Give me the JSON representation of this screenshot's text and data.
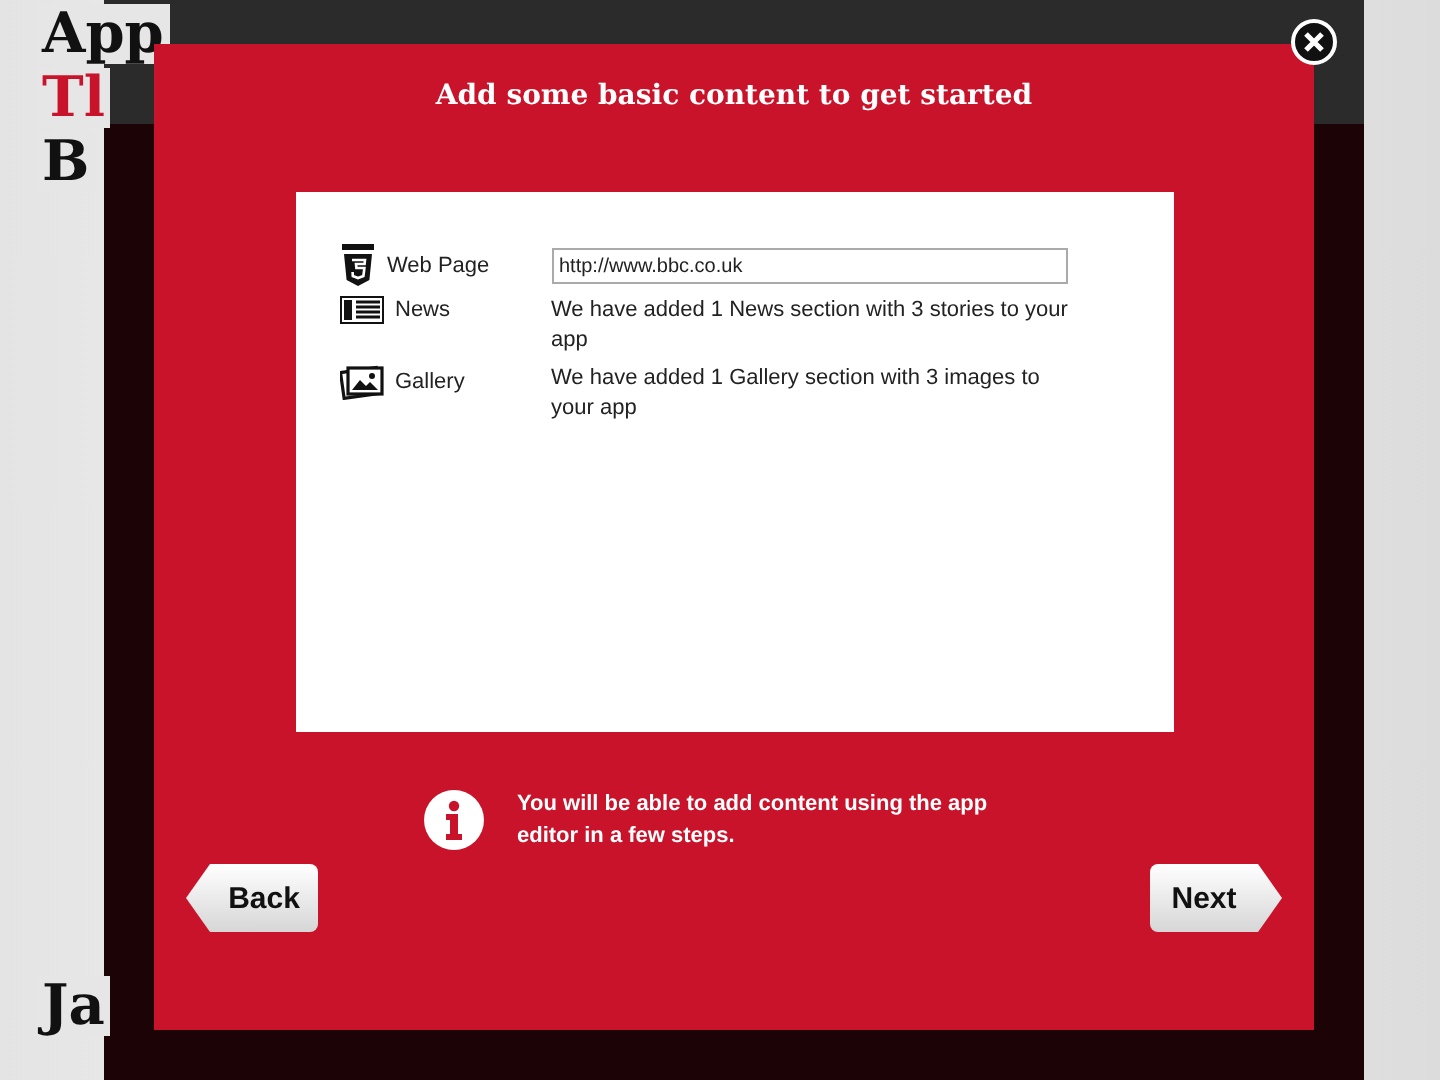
{
  "background": {
    "logo_fragments": [
      "App",
      "Tl",
      "B",
      "Ja"
    ]
  },
  "dialog": {
    "title": "Add some basic content to get started",
    "rows": [
      {
        "kind": "web",
        "label": "Web Page",
        "value": "http://www.bbc.co.uk"
      },
      {
        "kind": "news",
        "label": "News",
        "text": "We have added 1 News section with 3 stories to your app"
      },
      {
        "kind": "gallery",
        "label": "Gallery",
        "text": "We have added 1 Gallery section with 3 images to your app"
      }
    ],
    "info": "You will be able to add content using the app editor in a few steps.",
    "buttons": [
      {
        "kind": "back",
        "label": "Back"
      },
      {
        "kind": "next",
        "label": "Next"
      }
    ]
  }
}
